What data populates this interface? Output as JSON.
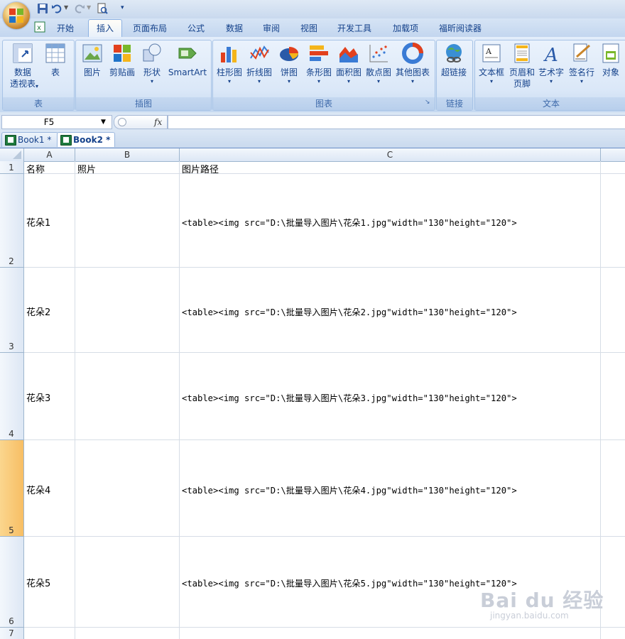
{
  "ribbon_tabs": [
    "开始",
    "插入",
    "页面布局",
    "公式",
    "数据",
    "审阅",
    "视图",
    "开发工具",
    "加载项",
    "福昕阅读器"
  ],
  "active_tab": "插入",
  "groups": {
    "table": {
      "label": "表",
      "buttons": [
        "数据\n透视表",
        "表"
      ]
    },
    "illustrations": {
      "label": "插图",
      "buttons": [
        "图片",
        "剪贴画",
        "形状",
        "SmartArt"
      ]
    },
    "charts": {
      "label": "图表",
      "buttons": [
        "柱形图",
        "折线图",
        "饼图",
        "条形图",
        "面积图",
        "散点图",
        "其他图表"
      ]
    },
    "links": {
      "label": "链接",
      "buttons": [
        "超链接"
      ]
    },
    "text": {
      "label": "文本",
      "buttons": [
        "文本框",
        "页眉和\n页脚",
        "艺术字",
        "签名行",
        "对象"
      ]
    }
  },
  "name_box": "F5",
  "fx": "fx",
  "workbooks": [
    "Book1 *",
    "Book2 *"
  ],
  "columns": [
    "A",
    "B",
    "C",
    ""
  ],
  "rows": [
    {
      "num": "1",
      "a": "名称",
      "b": "照片",
      "c": "图片路径"
    },
    {
      "num": "2",
      "a": "花朵1",
      "b": "",
      "c": "<table><img src=\"D:\\批量导入图片\\花朵1.jpg\"width=\"130\"height=\"120\">"
    },
    {
      "num": "3",
      "a": "花朵2",
      "b": "",
      "c": "<table><img src=\"D:\\批量导入图片\\花朵2.jpg\"width=\"130\"height=\"120\">"
    },
    {
      "num": "4",
      "a": "花朵3",
      "b": "",
      "c": "<table><img src=\"D:\\批量导入图片\\花朵3.jpg\"width=\"130\"height=\"120\">"
    },
    {
      "num": "5",
      "a": "花朵4",
      "b": "",
      "c": "<table><img src=\"D:\\批量导入图片\\花朵4.jpg\"width=\"130\"height=\"120\">"
    },
    {
      "num": "6",
      "a": "花朵5",
      "b": "",
      "c": "<table><img src=\"D:\\批量导入图片\\花朵5.jpg\"width=\"130\"height=\"120\">"
    },
    {
      "num": "7",
      "a": "",
      "b": "",
      "c": ""
    }
  ],
  "selected_row": "5",
  "watermark": {
    "main": "Bai du 经验",
    "sub": "jingyan.baidu.com"
  }
}
